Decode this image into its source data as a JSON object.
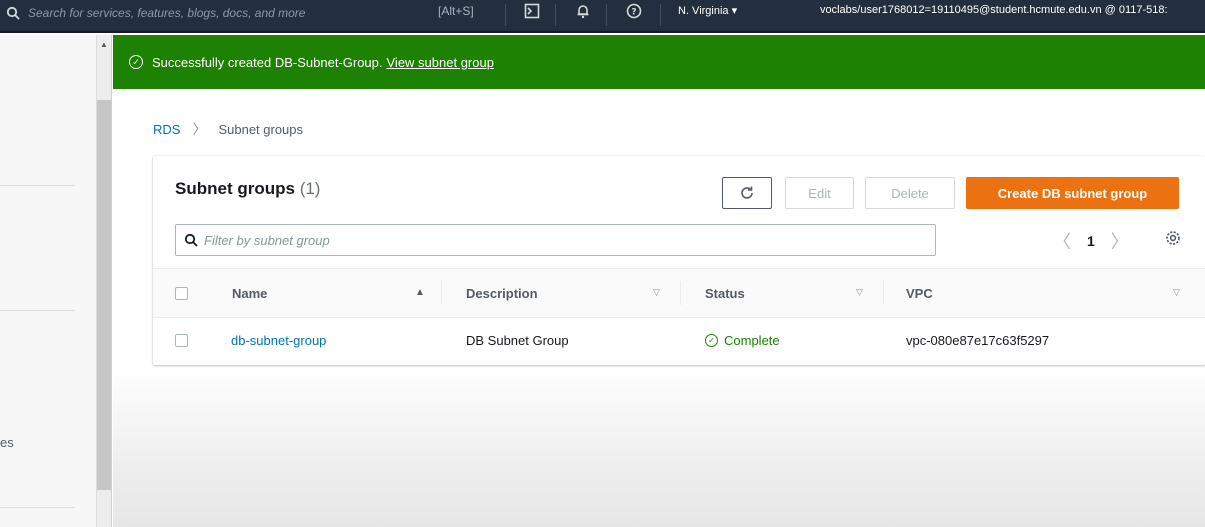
{
  "topbar": {
    "search_placeholder": "Search for services, features, blogs, docs, and more",
    "shortcut": "[Alt+S]",
    "region": "N. Virginia ▾",
    "account": "voclabs/user1768012=19110495@student.hcmute.edu.vn @ 0117-518:"
  },
  "leftnav": {
    "fragment": "es"
  },
  "flash": {
    "message": "Successfully created DB-Subnet-Group.",
    "link": "View subnet group",
    "color": "#1d8102"
  },
  "breadcrumb": {
    "items": [
      "RDS",
      "Subnet groups"
    ]
  },
  "panel": {
    "title": "Subnet groups",
    "count": "(1)",
    "buttons": {
      "edit": "Edit",
      "delete": "Delete",
      "create": "Create DB subnet group"
    },
    "filter_placeholder": "Filter by subnet group",
    "page": "1"
  },
  "table": {
    "columns": [
      "Name",
      "Description",
      "Status",
      "VPC"
    ],
    "rows": [
      {
        "name": "db-subnet-group",
        "description": "DB Subnet Group",
        "status": "Complete",
        "vpc": "vpc-080e87e17c63f5297"
      }
    ]
  },
  "colors": {
    "accent": "#ec7211",
    "link": "#0073bb",
    "success": "#1d8102",
    "topbar": "#232f3e"
  }
}
